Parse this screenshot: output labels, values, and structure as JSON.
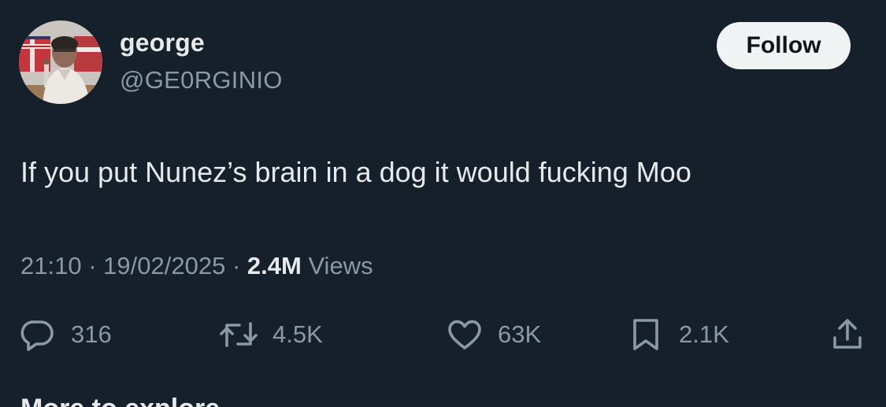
{
  "tweet": {
    "author": {
      "name": "george",
      "handle": "@GE0RGINIO"
    },
    "follow_label": "Follow",
    "text": "If you put Nunez’s brain in a dog it would fucking Moo",
    "meta": {
      "time": "21:10",
      "date": "19/02/2025",
      "views_count": "2.4M",
      "views_label": "Views",
      "separator": "·"
    },
    "stats": {
      "replies": "316",
      "retweets": "4.5K",
      "likes": "63K",
      "bookmarks": "2.1K"
    },
    "more_label": "More to explore"
  },
  "icons": {
    "reply": "reply-icon",
    "retweet": "retweet-icon",
    "like": "heart-icon",
    "bookmark": "bookmark-icon",
    "share": "share-icon"
  },
  "colors": {
    "background": "#15202b",
    "primary_text": "#e7e9ea",
    "secondary_text": "#8b98a5",
    "follow_bg": "#eff3f4",
    "follow_text": "#0f1419"
  }
}
